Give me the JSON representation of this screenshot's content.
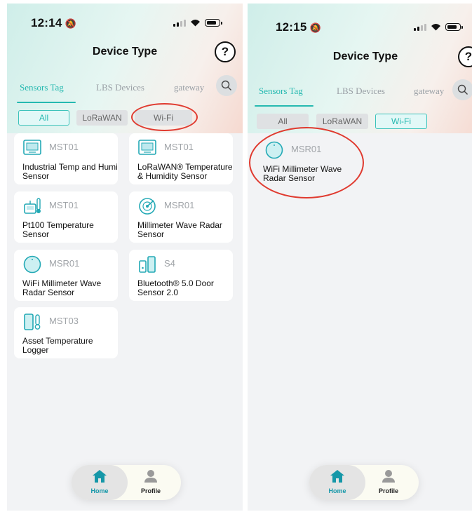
{
  "left": {
    "time": "12:14",
    "title": "Device Type",
    "help": "?",
    "tabs": [
      "Sensors Tag",
      "LBS Devices",
      "gateway"
    ],
    "filters": [
      "All",
      "LoRaWAN",
      "Wi-Fi"
    ],
    "active_filter": "All",
    "devices": [
      {
        "model": "MST01",
        "name": "Industrial Temp and Humi Sensor",
        "icon": "screen-sensor-icon"
      },
      {
        "model": "MST01",
        "name": "LoRaWAN® Temperature & Humidity Sensor",
        "icon": "screen-sensor-icon"
      },
      {
        "model": "MST01",
        "name": "Pt100 Temperature Sensor",
        "icon": "probe-sensor-icon"
      },
      {
        "model": "MSR01",
        "name": "Millimeter Wave Radar Sensor",
        "icon": "radar-icon"
      },
      {
        "model": "MSR01",
        "name": "WiFi Millimeter Wave Radar Sensor",
        "icon": "round-radar-icon"
      },
      {
        "model": "S4",
        "name": "Bluetooth® 5.0 Door Sensor 2.0",
        "icon": "door-sensor-icon"
      },
      {
        "model": "MST03",
        "name": "Asset Temperature Logger",
        "icon": "thermometer-logger-icon"
      }
    ],
    "nav": {
      "home": "Home",
      "profile": "Profile"
    }
  },
  "right": {
    "time": "12:15",
    "title": "Device Type",
    "help": "?",
    "tabs": [
      "Sensors Tag",
      "LBS Devices",
      "gateway"
    ],
    "filters": [
      "All",
      "LoRaWAN",
      "Wi-Fi"
    ],
    "active_filter": "Wi-Fi",
    "devices": [
      {
        "model": "MSR01",
        "name": "WiFi Millimeter Wave Radar Sensor",
        "icon": "round-radar-icon"
      }
    ],
    "nav": {
      "home": "Home",
      "profile": "Profile"
    }
  },
  "colors": {
    "accent": "#25b9b0",
    "annotation": "#e03a2f",
    "background": "#f2f3f5"
  }
}
